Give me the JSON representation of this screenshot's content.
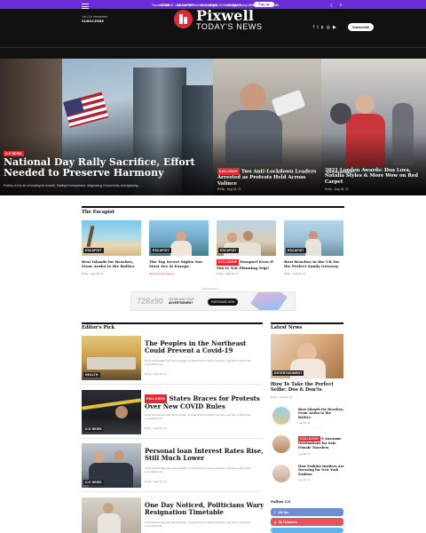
{
  "promo": {
    "text": "Save 25% off: Use our newsletter and get 25% off right away!",
    "signup": "Sign up"
  },
  "header": {
    "newsletter_line": "Get Our Newsletter",
    "subscribe": "SUBSCRIBE",
    "brand": "Pixwell",
    "tagline": "TODAY'S NEWS",
    "social_icons": [
      "facebook-icon",
      "twitter-icon",
      "pinterest-icon",
      "instagram-icon",
      "youtube-icon"
    ],
    "button": "Subscribe"
  },
  "nav": {
    "items": [
      "HOME",
      "ESCAPIST",
      "U.K NEWS",
      "CONTACT",
      "JOIN US",
      "BLOG"
    ]
  },
  "hero": {
    "main": {
      "tag": "U.K NEWS",
      "title": "National Day Rally Sacrifice, Effort Needed to Preserve Harmony",
      "excerpt": "Politics is the art of looking for trouble, finding it everywhere, diagnosing it incorrectly and applying ..."
    },
    "second": {
      "tag": "U.K NEWS",
      "tag2": "EXCLUSIVE",
      "title": "Two Anti-Lockdown Leaders Arrested as Protests Held Across Valince",
      "author": "Emily",
      "date": "Aug 18, 21"
    },
    "third": {
      "tag": "ENTERTAINMENT",
      "title": "2021 London Awards: Dua Lova, Natalia Styles & More Wow on Red Carpet",
      "author": "Emily",
      "date": "Aug 18, 21"
    }
  },
  "escapist": {
    "title": "The Escapist",
    "cards": [
      {
        "tag": "ESCAPIST",
        "title": "Best Islands for Beaches, From Aruba to the Baltics",
        "author": "Emily",
        "date": "Aug 18, 21"
      },
      {
        "tag": "ESCAPIST",
        "title": "The Top Secret Sights You Must See in Europe",
        "sponsor": "Sponsored by Dream"
      },
      {
        "tag": "ESCAPIST",
        "label": "EXCLUSIVE",
        "title": "Passport Even if You're Not Planning Trip?",
        "author": "Emily",
        "date": "Aug 18, 21"
      },
      {
        "tag": "ESCAPIST",
        "title": "Best Beaches in the UK for the Perfect Sandy Getaway",
        "author": "Emily",
        "date": "Aug 18, 21"
      }
    ]
  },
  "ad": {
    "label": "- Advertisement -",
    "size": "728x90",
    "line1": "SHOWCASE YOUR",
    "line2": "ADVERTISEMENT",
    "button": "PURCHASE NOW"
  },
  "editors_pick": {
    "title": "Editor's Pick",
    "items": [
      {
        "tag": "HEALTH",
        "title": "The Peoples in the Northeast Could Prevent a Covid-19",
        "excerpt": "Good web design has visual weight, is optimized for various devices, and has content that is prioritized for ...",
        "author": "Emily",
        "date": "Aug 18, 21"
      },
      {
        "tag": "U.K NEWS",
        "label": "EXCLUSIVE",
        "title": "States Braces for Protests Over New COVID Rules",
        "excerpt": "Good web design has visual weight, is optimized for various devices, and has content that is prioritized for ...",
        "author": "Emily",
        "date": "Aug 18, 21"
      },
      {
        "tag": "U.K NEWS",
        "title": "Personal loan Interest Rates Rise, Still Much Lower",
        "excerpt": "Good web design has visual weight, is optimized for various devices, and has content that is prioritized for ...",
        "author": "Emily",
        "date": "Aug 18, 21"
      },
      {
        "tag": "U.K NEWS",
        "title": "One Day Noticed, Politicians Wary Resignation Timetable",
        "excerpt": "Good web design has visual weight, is optimized for various devices, and has content that is prioritized for ..."
      }
    ]
  },
  "latest": {
    "title": "Latest News",
    "big": {
      "tag": "ENTERTAINMENT",
      "title": "How To Take the Perfect Selfie: Dos & Don'ts",
      "author": "Emily",
      "date": "Aug 18, 21"
    },
    "items": [
      {
        "title": "Best Islands for Beaches, From Aruba to the Baltics",
        "date": "Aug 18, 21"
      },
      {
        "label": "EXCLUSIVE",
        "title": "9 Awesome Destinations for Solo Female Travelers",
        "date": "Aug 18, 21"
      },
      {
        "title": "How Fashion Insiders Are Dressing for New York Fashion",
        "date": "Aug 18, 21"
      }
    ],
    "follow_title": "Follow US",
    "follow": [
      {
        "label": "10k fan",
        "color": "#3b5998",
        "icon": "facebook-icon"
      },
      {
        "label": "2k Followers",
        "color": "#e02a34",
        "icon": "pinterest-icon"
      },
      {
        "label": "",
        "color": "#1da1f2",
        "icon": "twitter-icon"
      }
    ]
  }
}
